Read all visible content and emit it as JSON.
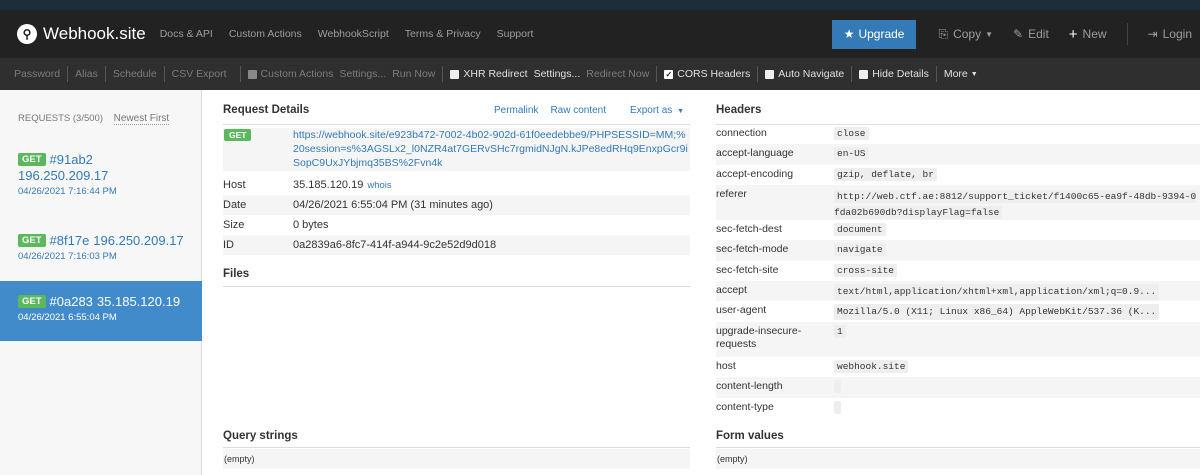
{
  "brand": {
    "logo_glyph": "⚲",
    "name": "Webhook.site"
  },
  "nav": {
    "links": [
      "Docs & API",
      "Custom Actions",
      "WebhookScript",
      "Terms & Privacy",
      "Support"
    ],
    "upgrade": "Upgrade",
    "copy": "Copy",
    "edit": "Edit",
    "new": "New",
    "login": "Login"
  },
  "toolbar": {
    "password": "Password",
    "alias": "Alias",
    "schedule": "Schedule",
    "csv_export": "CSV Export",
    "custom_actions": "Custom Actions",
    "settings1": "Settings...",
    "run_now": "Run Now",
    "xhr_redirect": "XHR Redirect",
    "settings2": "Settings...",
    "redirect_now": "Redirect Now",
    "cors_headers": "CORS Headers",
    "auto_navigate": "Auto Navigate",
    "hide_details": "Hide Details",
    "more": "More"
  },
  "sidebar": {
    "requests_label": "REQUESTS (3/500)",
    "sort_label": "Newest First",
    "requests": [
      {
        "method": "GET",
        "id": "#91ab2",
        "ip": "196.250.209.17",
        "date": "04/26/2021 7:16:44 PM",
        "selected": false
      },
      {
        "method": "GET",
        "id": "#8f17e",
        "ip": "196.250.209.17",
        "date": "04/26/2021 7:16:03 PM",
        "selected": false
      },
      {
        "method": "GET",
        "id": "#0a283",
        "ip": "35.185.120.19",
        "date": "04/26/2021 6:55:04 PM",
        "selected": true
      }
    ]
  },
  "details": {
    "title": "Request Details",
    "permalink": "Permalink",
    "raw_content": "Raw content",
    "export_as": "Export as",
    "method": "GET",
    "url": "https://webhook.site/e923b472-7002-4b02-902d-61f0eedebbe9/PHPSESSID=MM;%20session=s%3AGSLx2_l0NZR4at7GERvSHc7rgmidNJgN.kJPe8edRHq9EnxpGcr9iSopC9UxJYbjmq35BS%2Fvn4k",
    "host_label": "Host",
    "host": "35.185.120.19",
    "whois": "whois",
    "date_label": "Date",
    "date": "04/26/2021 6:55:04 PM (31 minutes ago)",
    "size_label": "Size",
    "size": "0 bytes",
    "id_label": "ID",
    "id": "0a2839a6-8fc7-414f-a944-9c2e52d9d018",
    "files_title": "Files",
    "query_title": "Query strings",
    "query_empty": "(empty)"
  },
  "headers": {
    "title": "Headers",
    "rows": [
      {
        "k": "connection",
        "v": "close"
      },
      {
        "k": "accept-language",
        "v": "en-US"
      },
      {
        "k": "accept-encoding",
        "v": "gzip, deflate, br"
      },
      {
        "k": "referer",
        "v": "http://web.ctf.ae:8812/support_ticket/f1400c65-ea9f-48db-9394-0fda02b690db?displayFlag=false"
      },
      {
        "k": "sec-fetch-dest",
        "v": "document"
      },
      {
        "k": "sec-fetch-mode",
        "v": "navigate"
      },
      {
        "k": "sec-fetch-site",
        "v": "cross-site"
      },
      {
        "k": "accept",
        "v": "text/html,application/xhtml+xml,application/xml;q=0.9..."
      },
      {
        "k": "user-agent",
        "v": "Mozilla/5.0 (X11; Linux x86_64) AppleWebKit/537.36 (K..."
      },
      {
        "k": "upgrade-insecure-requests",
        "v": "1"
      },
      {
        "k": "host",
        "v": "webhook.site"
      },
      {
        "k": "content-length",
        "v": ""
      },
      {
        "k": "content-type",
        "v": ""
      }
    ],
    "form_title": "Form values",
    "form_empty": "(empty)"
  }
}
